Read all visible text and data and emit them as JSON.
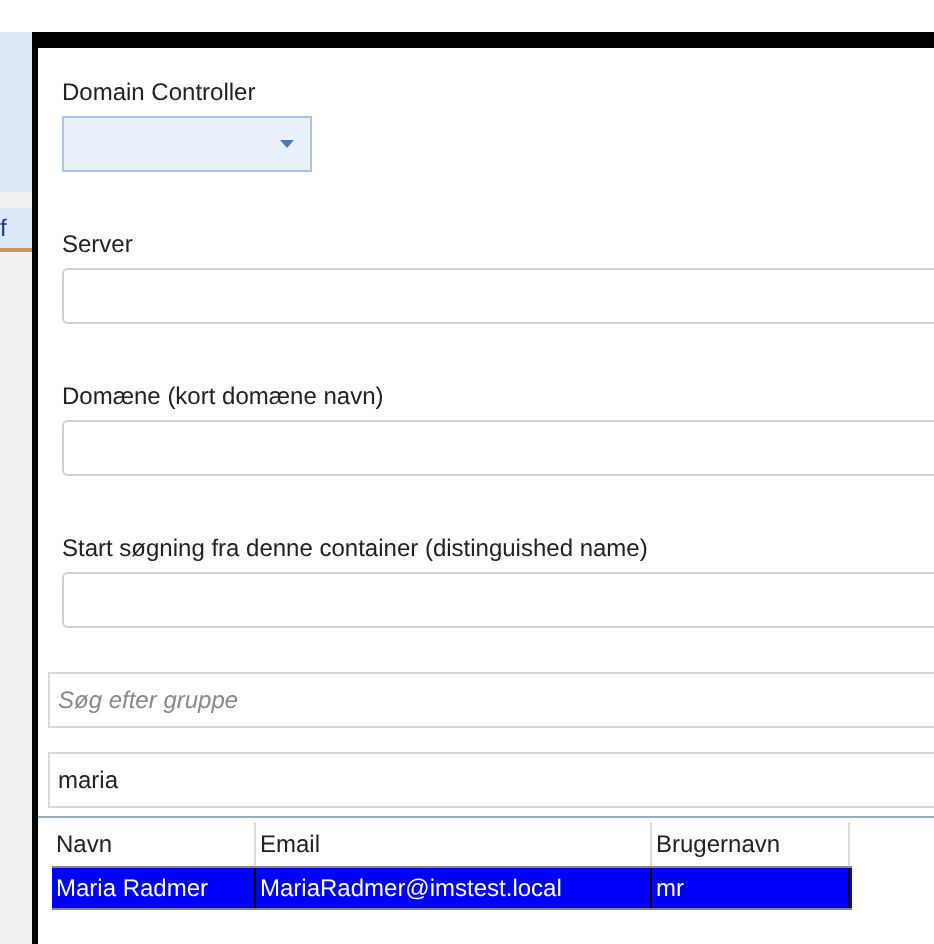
{
  "background_window": {
    "fragment": "f"
  },
  "fields": [
    {
      "label": "Domain Controller",
      "kind": "combo"
    },
    {
      "label": "Server",
      "kind": "text"
    },
    {
      "label": "Domæne (kort domæne navn)",
      "kind": "text"
    },
    {
      "label": "Start søgning fra denne container (distinguished name)",
      "kind": "text"
    }
  ],
  "group_search": {
    "placeholder": "Søg efter gruppe"
  },
  "user_search": {
    "value": "maria"
  },
  "table": {
    "columns": [
      "Navn",
      "Email",
      "Brugernavn"
    ],
    "rows": [
      {
        "cells": [
          "Maria Radmer",
          "MariaRadmer@imstest.local",
          "mr"
        ],
        "selected": true
      }
    ]
  }
}
